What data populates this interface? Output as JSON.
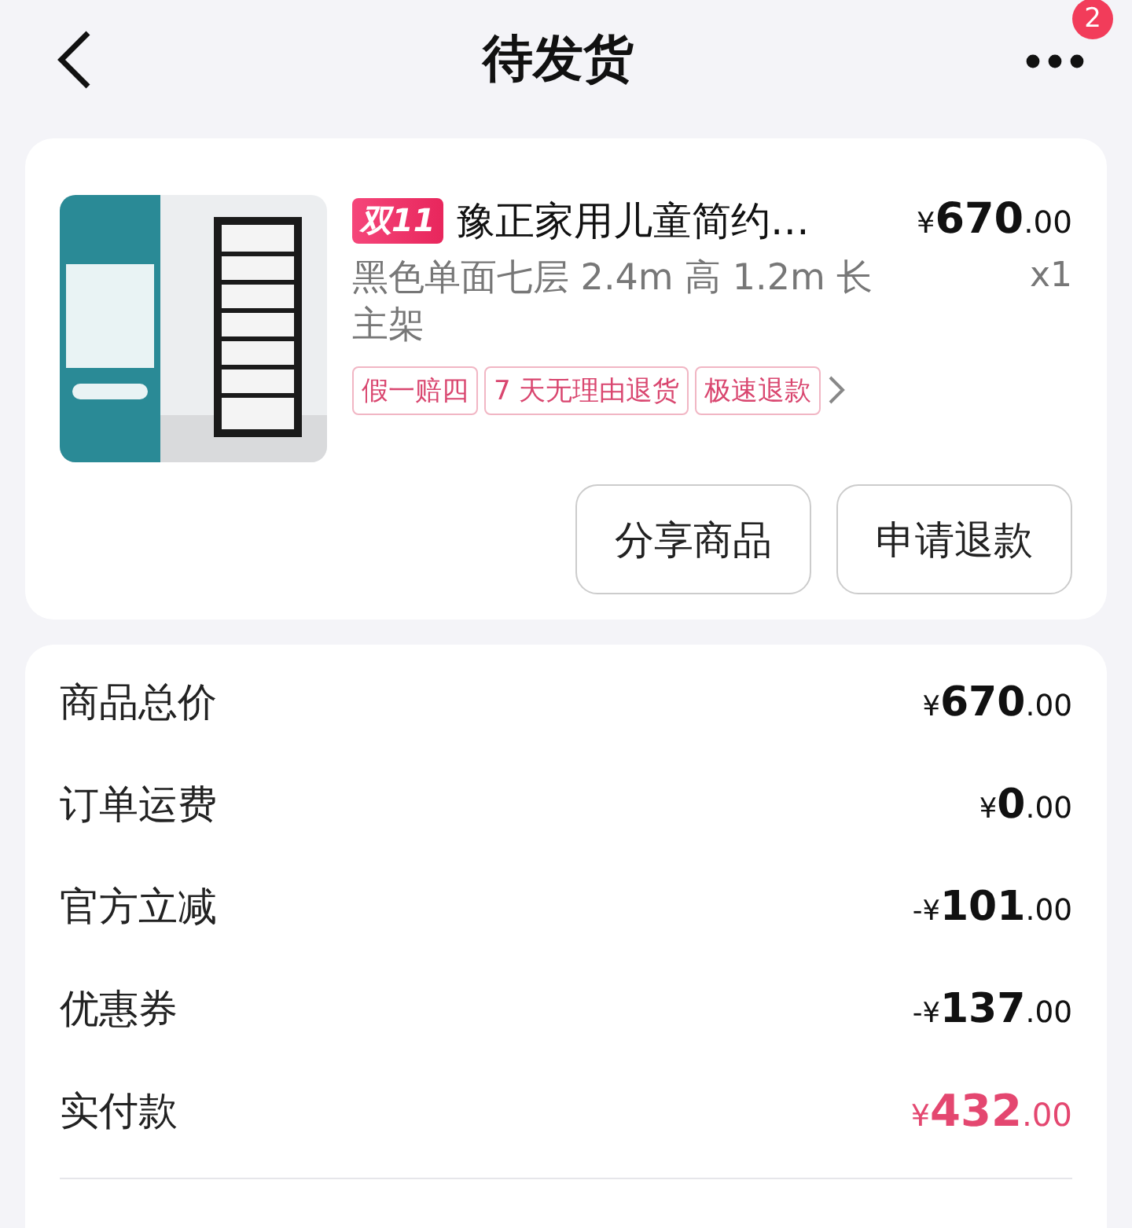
{
  "header": {
    "title": "待发货",
    "badge": "2"
  },
  "product": {
    "promo": "双11",
    "title": "豫正家用儿童简约…",
    "price": {
      "prefix": "¥",
      "main": "670",
      "fraction": ".00"
    },
    "spec": "黑色单面七层 2.4m 高 1.2m 长主架",
    "quantity": "x1",
    "tags": [
      "假一赔四",
      "7 天无理由退货",
      "极速退款"
    ]
  },
  "actions": [
    "分享商品",
    "申请退款"
  ],
  "summary": [
    {
      "label": "商品总价",
      "amount": {
        "prefix": "¥",
        "main": "670",
        "fraction": ".00"
      },
      "emphasis": false
    },
    {
      "label": "订单运费",
      "amount": {
        "prefix": "¥",
        "main": "0",
        "fraction": ".00"
      },
      "emphasis": false
    },
    {
      "label": "官方立减",
      "amount": {
        "prefix": "-¥",
        "main": "101",
        "fraction": ".00"
      },
      "emphasis": false
    },
    {
      "label": "优惠券",
      "amount": {
        "prefix": "-¥",
        "main": "137",
        "fraction": ".00"
      },
      "emphasis": false
    },
    {
      "label": "实付款",
      "amount": {
        "prefix": "¥",
        "main": "432",
        "fraction": ".00"
      },
      "emphasis": true
    }
  ]
}
